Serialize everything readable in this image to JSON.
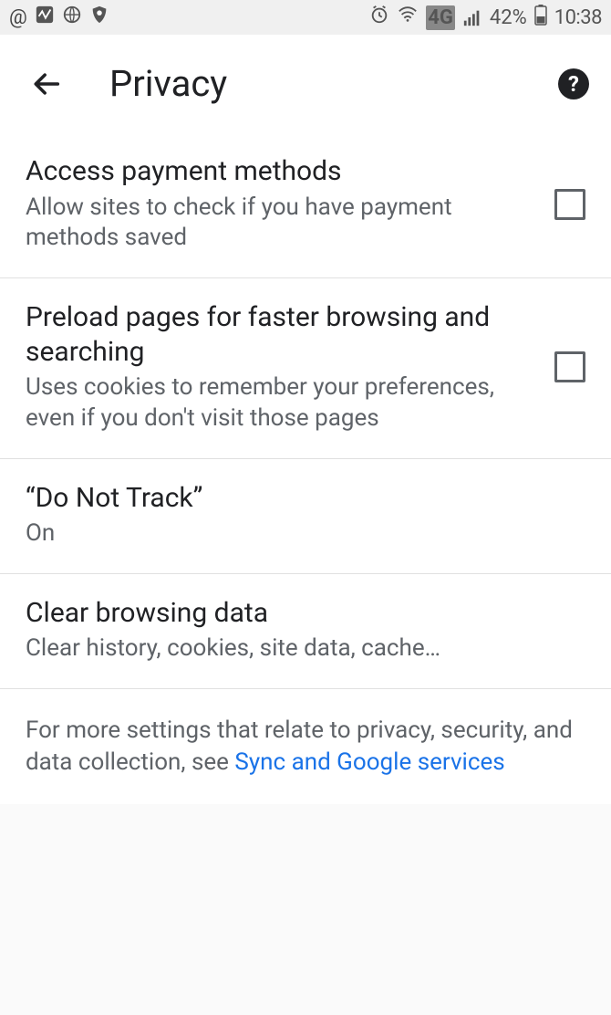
{
  "status": {
    "icons_left": [
      "@",
      "chart",
      "globe",
      "shield"
    ],
    "icons_right": [
      "alarm",
      "wifi"
    ],
    "network_badge": "4G",
    "battery_percent": "42%",
    "clock": "10:38"
  },
  "appbar": {
    "title": "Privacy"
  },
  "settings": [
    {
      "title": "Access payment methods",
      "subtitle": "Allow sites to check if you have payment methods saved",
      "checkbox": true,
      "checked": false
    },
    {
      "title": "Preload pages for faster browsing and searching",
      "subtitle": "Uses cookies to remember your preferences, even if you don't visit those pages",
      "checkbox": true,
      "checked": false
    },
    {
      "title": "“Do Not Track”",
      "subtitle": "On",
      "checkbox": false
    },
    {
      "title": "Clear browsing data",
      "subtitle": "Clear history, cookies, site data, cache…",
      "checkbox": false
    }
  ],
  "footer": {
    "prefix": "For more settings that relate to privacy, security, and data collection, see ",
    "link": "Sync and Google services"
  }
}
